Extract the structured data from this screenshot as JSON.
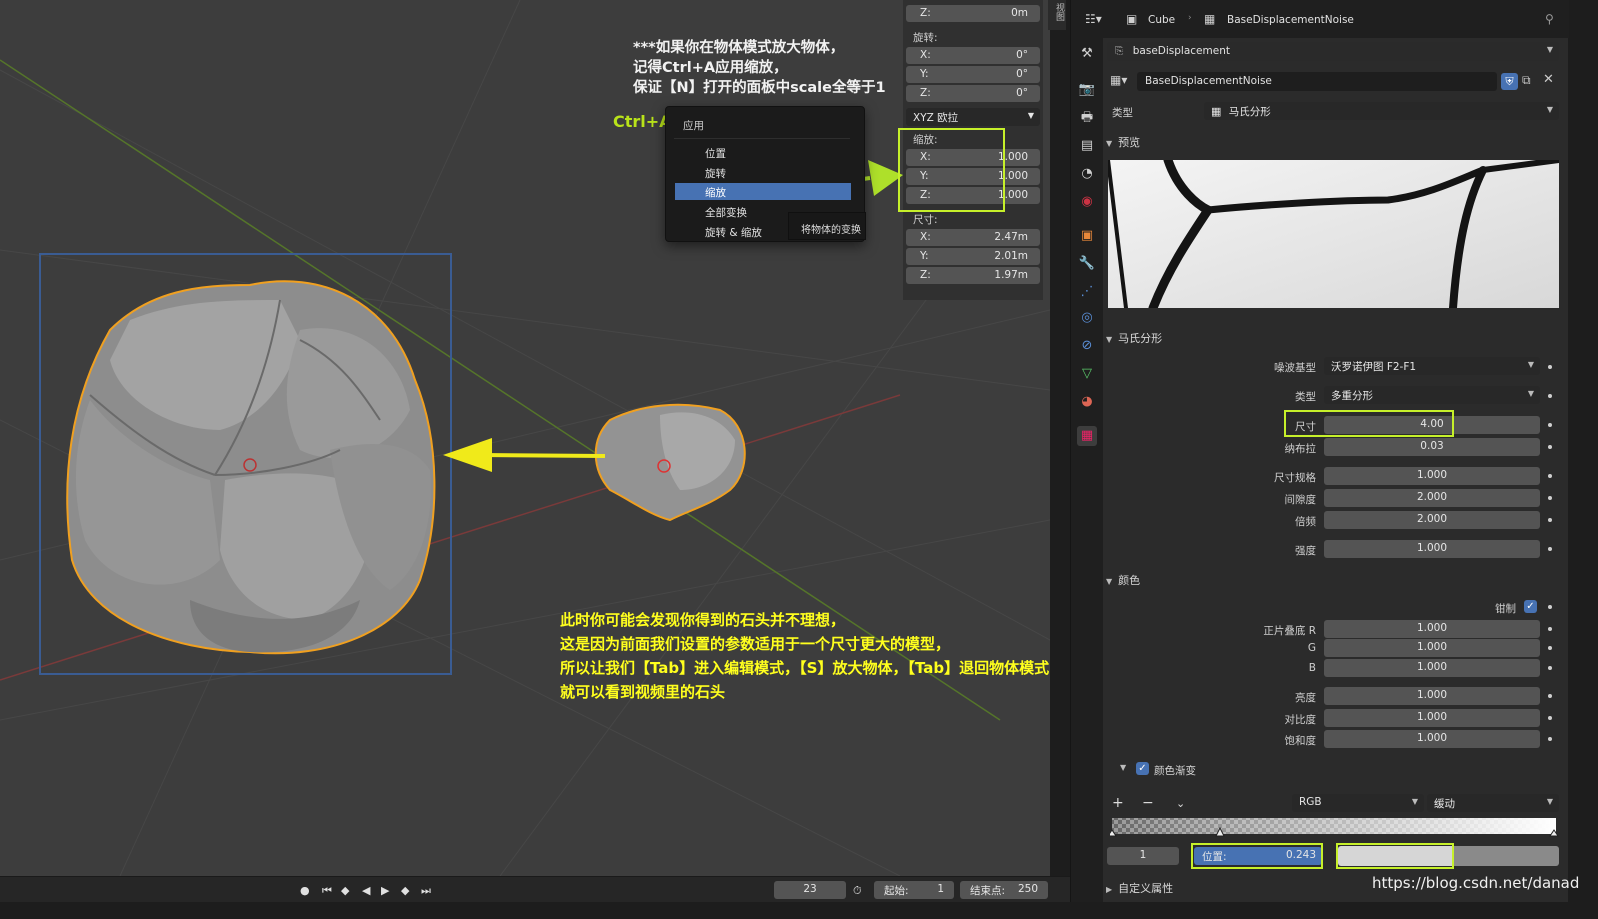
{
  "npanel": {
    "location_z": {
      "axis": "Z:",
      "value": "0m"
    },
    "rotation_label": "旋转:",
    "rotation": [
      {
        "axis": "X:",
        "value": "0°"
      },
      {
        "axis": "Y:",
        "value": "0°"
      },
      {
        "axis": "Z:",
        "value": "0°"
      }
    ],
    "rotation_mode": "XYZ 欧拉",
    "scale_label": "缩放:",
    "scale": [
      {
        "axis": "X:",
        "value": "1.000"
      },
      {
        "axis": "Y:",
        "value": "1.000"
      },
      {
        "axis": "Z:",
        "value": "1.000"
      }
    ],
    "dimensions_label": "尺寸:",
    "dimensions": [
      {
        "axis": "X:",
        "value": "2.47m"
      },
      {
        "axis": "Y:",
        "value": "2.01m"
      },
      {
        "axis": "Z:",
        "value": "1.97m"
      }
    ],
    "side_tab": "视图"
  },
  "context_menu": {
    "title": "应用",
    "items": [
      "位置",
      "旋转",
      "缩放",
      "全部变换",
      "旋转 & 缩放"
    ],
    "active_index": 2,
    "tooltip": "将物体的变换"
  },
  "annotations": {
    "top_lines": [
      "***如果你在物体模式放大物体，",
      "记得Ctrl+A应用缩放，",
      "保证【N】打开的面板中scale全等于1"
    ],
    "ctrl_a": "Ctrl+A",
    "bottom_lines": [
      "此时你可能会发现你得到的石头并不理想，",
      "这是因为前面我们设置的参数适用于一个尺寸更大的模型，",
      "所以让我们【Tab】进入编辑模式，【S】放大物体，【Tab】退回物体模式，",
      "就可以看到视频里的石头"
    ]
  },
  "timeline": {
    "current_frame": "23",
    "start_label": "起始:",
    "start_value": "1",
    "end_label": "结束点:",
    "end_value": "250"
  },
  "properties": {
    "breadcrumb": {
      "object": "Cube",
      "texture": "BaseDisplacementNoise"
    },
    "modifier_name": "baseDisplacement",
    "texture_name": "BaseDisplacementNoise",
    "type_label": "类型",
    "type_value": "马氏分形",
    "preview_label": "预览",
    "musgrave_section": "马氏分形",
    "musgrave": {
      "noise_basis_label": "噪波基型",
      "noise_basis_value": "沃罗诺伊图 F2-F1",
      "type_label": "类型",
      "type_value": "多重分形",
      "size_label": "尺寸",
      "size_value": "4.00",
      "nabla_label": "纳布拉",
      "nabla_value": "0.03",
      "dimension_label": "尺寸规格",
      "dimension_value": "1.000",
      "lacunarity_label": "间隙度",
      "lacunarity_value": "2.000",
      "octaves_label": "倍频",
      "octaves_value": "2.000",
      "intensity_label": "强度",
      "intensity_value": "1.000"
    },
    "colors_section": "颜色",
    "colors": {
      "clamp_label": "钳制",
      "r_label": "正片叠底 R",
      "r_value": "1.000",
      "g_label": "G",
      "g_value": "1.000",
      "b_label": "B",
      "b_value": "1.000",
      "brightness_label": "亮度",
      "brightness_value": "1.000",
      "contrast_label": "对比度",
      "contrast_value": "1.000",
      "saturation_label": "饱和度",
      "saturation_value": "1.000"
    },
    "ramp": {
      "label": "颜色渐变",
      "add": "+",
      "remove": "−",
      "color_mode": "RGB",
      "interpolation": "缓动",
      "stop_index": "1",
      "position_label": "位置:",
      "position_value": "0.243"
    },
    "custom_props": "自定义属性"
  },
  "watermark": "https://blog.csdn.net/danad",
  "colors": {
    "accent": "#4772b3",
    "highlight": "#c6f02a",
    "annotation": "#ffff1e",
    "selection_outline": "#f0a020"
  }
}
